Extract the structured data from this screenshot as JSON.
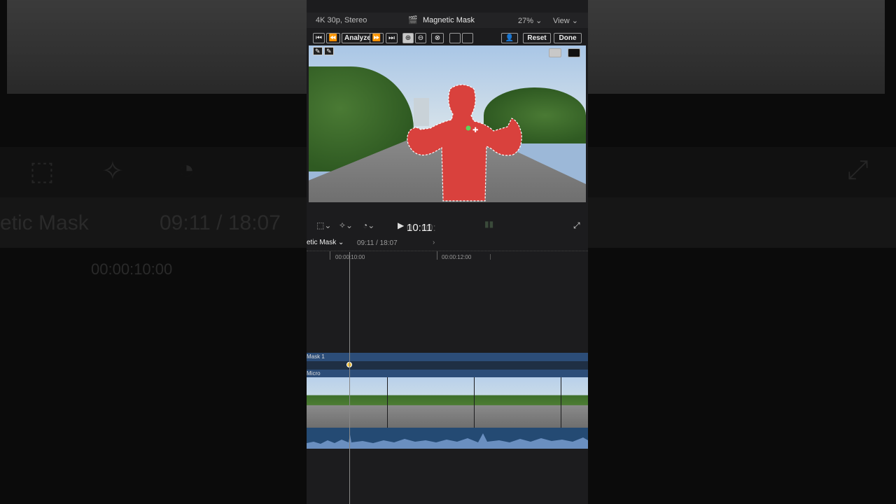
{
  "background": {
    "clip_name": "etic Mask",
    "timecode": "09:11 / 18:07",
    "playhead_tc": "00:00:10:00"
  },
  "topbar": {
    "format": "4K 30p, Stereo",
    "title": "Magnetic Mask",
    "zoom": "27%",
    "view": "View"
  },
  "toolbar": {
    "analyze": "Analyze",
    "reset": "Reset",
    "done": "Done"
  },
  "controls": {
    "timecode_dim": "00:00:",
    "timecode_bright": "10:11"
  },
  "timeline": {
    "clip_name": "etic Mask",
    "timecode": "09:11 / 18:07",
    "ruler_marks": [
      "00:00:10:00",
      "00:00:12:00"
    ],
    "mask_label": "Mask 1",
    "clip_label": "Micro"
  },
  "colors": {
    "mask_overlay": "#d9413d",
    "track_blue": "#2c4d78",
    "keyframe": "#f3c23a"
  }
}
